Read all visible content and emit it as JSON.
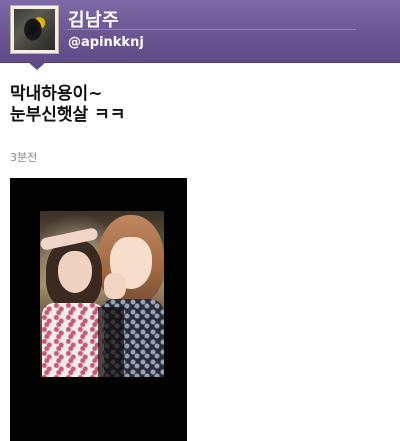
{
  "header": {
    "user_name": "김남주",
    "user_handle": "@apinkknj",
    "colors": {
      "header_bg": "#6a5693"
    }
  },
  "tweet": {
    "lines": [
      "막내하용이~",
      "눈부신햇살 ㅋㅋ"
    ],
    "timestamp": "3분전"
  },
  "photo": {
    "description_icon": "photo-attachment-icon"
  }
}
